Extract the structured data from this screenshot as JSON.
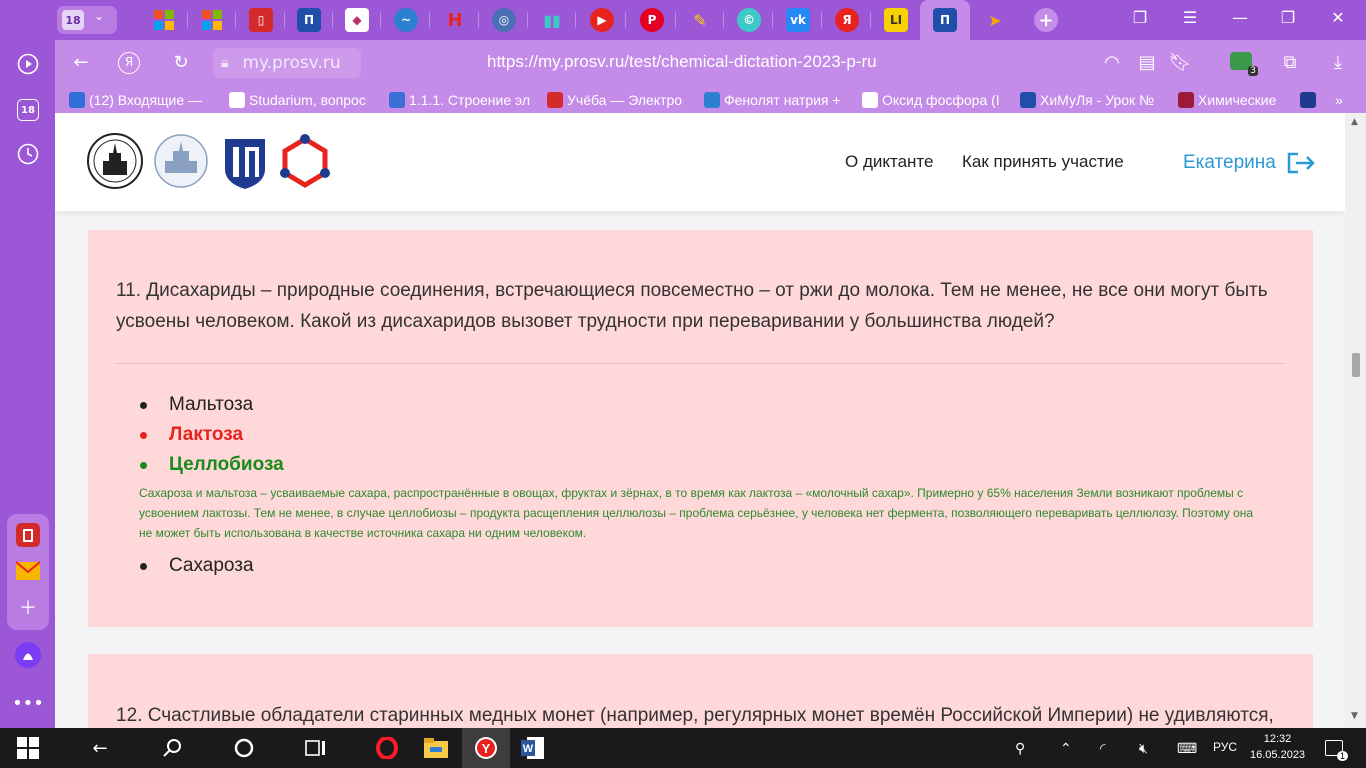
{
  "browser": {
    "tab_count": "18",
    "url_domain": "my.prosv.ru",
    "url_full": "https://my.prosv.ru/test/chemical-dictation-2023-p-ru",
    "sidebar_count": "18",
    "extension_badge": "3",
    "bookmarks": [
      {
        "label": "(12) Входящие —",
        "color": "#2f6fd6"
      },
      {
        "label": "Studarium, вопрос",
        "color": "#ffffff"
      },
      {
        "label": "1.1.1. Строение эл",
        "color": "#3a6fd8"
      },
      {
        "label": "Учёба — Электро",
        "color": "#d42a2a"
      },
      {
        "label": "Фенолят натрия +",
        "color": "#2d7fd0"
      },
      {
        "label": "Оксид фосфора (I",
        "color": "#ffffff"
      },
      {
        "label": "ХиМуЛя - Урок №",
        "color": "#1f4fa8"
      },
      {
        "label": "Химические",
        "color": "#9b1a3a"
      }
    ]
  },
  "site": {
    "nav": {
      "about": "О диктанте",
      "howto": "Как принять участие",
      "user": "Екатерина"
    }
  },
  "q11": {
    "text": "11. Дисахариды – природные соединения, встречающиеся повсеместно – от ржи до молока. Тем не менее, не все они могут быть усвоены человеком. Какой из дисахаридов вызовет трудности при переваривании у большинства людей?",
    "options": [
      {
        "label": "Мальтоза",
        "state": "neutral"
      },
      {
        "label": "Лактоза",
        "state": "wrong"
      },
      {
        "label": "Целлобиоза",
        "state": "correct"
      },
      {
        "label": "Сахароза",
        "state": "neutral"
      }
    ],
    "explanation": "Сахароза и мальтоза – усваиваемые сахара, распространённые в овощах, фруктах и зёрнах, в то время как лактоза – «молочный сахар». Примерно у 65% населения Земли возникают проблемы с усвоением лактозы. Тем не менее, в случае целлобиозы – продукта расщепления целлюлозы – проблема серьёзнее, у человека нет фермента, позволяющего переваривать целлюлозу. Поэтому она не может быть использована в качестве источника сахара ни одним человеком."
  },
  "q12": {
    "text": "12. Счастливые обладатели старинных медных монет (например, регулярных монет времён Российской Империи) не удивляются,"
  },
  "colors": {
    "wrong": "#e8231f",
    "correct": "#1a8a1a",
    "card_bg": "#ffd9d9",
    "browser_purple": "#9b57d6",
    "link_blue": "#2b9ad4"
  },
  "taskbar": {
    "lang": "РУС",
    "time": "12:32",
    "date": "16.05.2023",
    "notifications": "1"
  }
}
